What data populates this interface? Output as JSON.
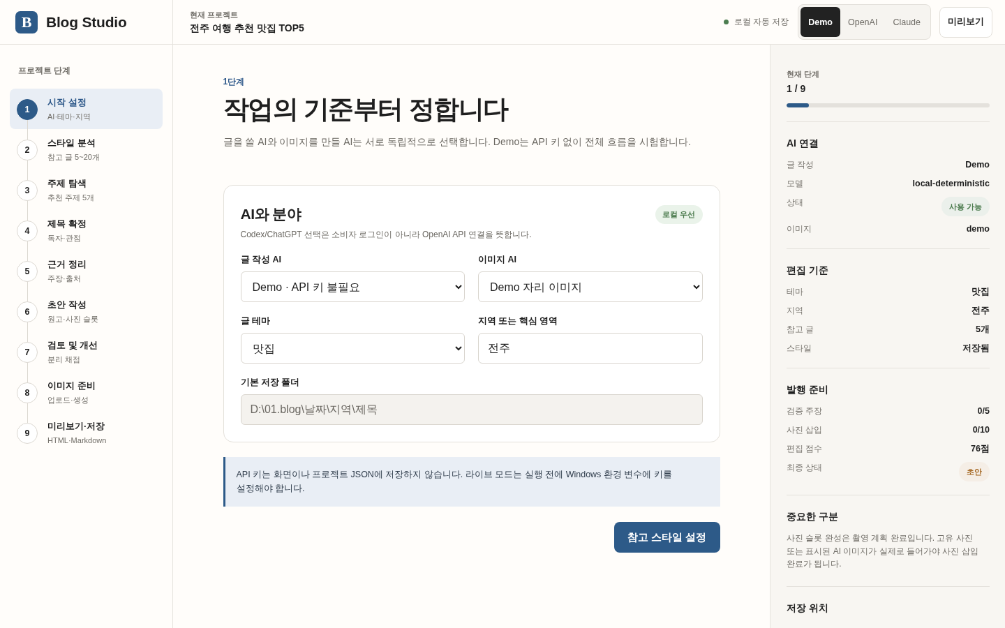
{
  "header": {
    "logo_letter": "B",
    "app_name": "Blog Studio",
    "project_label": "현재 프로젝트",
    "project_title": "전주 여행 추천 맛집 TOP5",
    "save_status": "로컬 자동 저장",
    "providers": [
      {
        "label": "Demo",
        "selected": true
      },
      {
        "label": "OpenAI",
        "selected": false
      },
      {
        "label": "Claude",
        "selected": false
      }
    ],
    "preview_button": "미리보기"
  },
  "sidebar": {
    "title": "프로젝트 단계",
    "steps": [
      {
        "number": "1",
        "title": "시작 설정",
        "subtitle": "AI·테마·지역",
        "selected": true
      },
      {
        "number": "2",
        "title": "스타일 분석",
        "subtitle": "참고 글 5~20개",
        "selected": false
      },
      {
        "number": "3",
        "title": "주제 탐색",
        "subtitle": "추천 주제 5개",
        "selected": false
      },
      {
        "number": "4",
        "title": "제목 확정",
        "subtitle": "독자·관점",
        "selected": false
      },
      {
        "number": "5",
        "title": "근거 정리",
        "subtitle": "주장·출처",
        "selected": false
      },
      {
        "number": "6",
        "title": "초안 작성",
        "subtitle": "원고·사진 슬롯",
        "selected": false
      },
      {
        "number": "7",
        "title": "검토 및 개선",
        "subtitle": "분리 채점",
        "selected": false
      },
      {
        "number": "8",
        "title": "이미지 준비",
        "subtitle": "업로드·생성",
        "selected": false
      },
      {
        "number": "9",
        "title": "미리보기·저장",
        "subtitle": "HTML·Markdown",
        "selected": false
      }
    ]
  },
  "main": {
    "step_label": "1단계",
    "title": "작업의 기준부터 정합니다",
    "description": "글을 쓸 AI와 이미지를 만들 AI는 서로 독립적으로 선택합니다. Demo는 API 키 없이 전체 흐름을 시험합니다.",
    "card": {
      "title": "AI와 분야",
      "tag": "로컬 우선",
      "note": "Codex/ChatGPT 선택은 소비자 로그인이 아니라 OpenAI API 연결을 뜻합니다.",
      "field_rows": [
        [
          {
            "kind": "select",
            "label": "글 작성 AI",
            "value": "Demo · API 키 불필요",
            "disabled": false
          },
          {
            "kind": "select",
            "label": "이미지 AI",
            "value": "Demo 자리 이미지",
            "disabled": false
          }
        ],
        [
          {
            "kind": "select",
            "label": "글 테마",
            "value": "맛집",
            "disabled": false
          },
          {
            "kind": "text",
            "label": "지역 또는 핵심 영역",
            "value": "전주",
            "disabled": false
          }
        ],
        [
          {
            "kind": "text",
            "label": "기본 저장 폴더",
            "value": "D:\\01.blog\\날짜\\지역\\제목",
            "disabled": true
          }
        ]
      ]
    },
    "notice": "API 키는 화면이나 프로젝트 JSON에 저장하지 않습니다. 라이브 모드는 실행 전에 Windows 환경 변수에 키를 설정해야 합니다.",
    "next_button": "참고 스타일 설정"
  },
  "summary": {
    "progress": {
      "label": "현재 단계",
      "value": "1 / 9",
      "level": 0.111
    },
    "sections": [
      {
        "title": "AI 연결",
        "rows": [
          {
            "kind": "text",
            "label": "글 작성",
            "value": "Demo"
          },
          {
            "kind": "text",
            "label": "모델",
            "value": "local-deterministic"
          },
          {
            "kind": "tag",
            "label": "상태",
            "value": "사용 가능",
            "color": "#4a7a4c"
          },
          {
            "kind": "text",
            "label": "이미지",
            "value": "demo"
          }
        ]
      },
      {
        "title": "편집 기준",
        "rows": [
          {
            "kind": "text",
            "label": "테마",
            "value": "맛집"
          },
          {
            "kind": "text",
            "label": "지역",
            "value": "전주"
          },
          {
            "kind": "text",
            "label": "참고 글",
            "value": "5개"
          },
          {
            "kind": "text",
            "label": "스타일",
            "value": "저장됨"
          }
        ]
      },
      {
        "title": "발행 준비",
        "rows": [
          {
            "kind": "text",
            "label": "검증 주장",
            "value": "0/5"
          },
          {
            "kind": "text",
            "label": "사진 삽입",
            "value": "0/10"
          },
          {
            "kind": "text",
            "label": "편집 점수",
            "value": "76점"
          },
          {
            "kind": "tag",
            "label": "최종 상태",
            "value": "초안",
            "color": "#a3651f"
          }
        ]
      },
      {
        "title": "중요한 구분",
        "text": "사진 슬롯 완성은 촬영 계획 완료입니다. 고유 사진 또는 표시된 AI 이미지가 실제로 들어가야 사진 삽입 완료가 됩니다."
      },
      {
        "title": "저장 위치"
      }
    ]
  }
}
